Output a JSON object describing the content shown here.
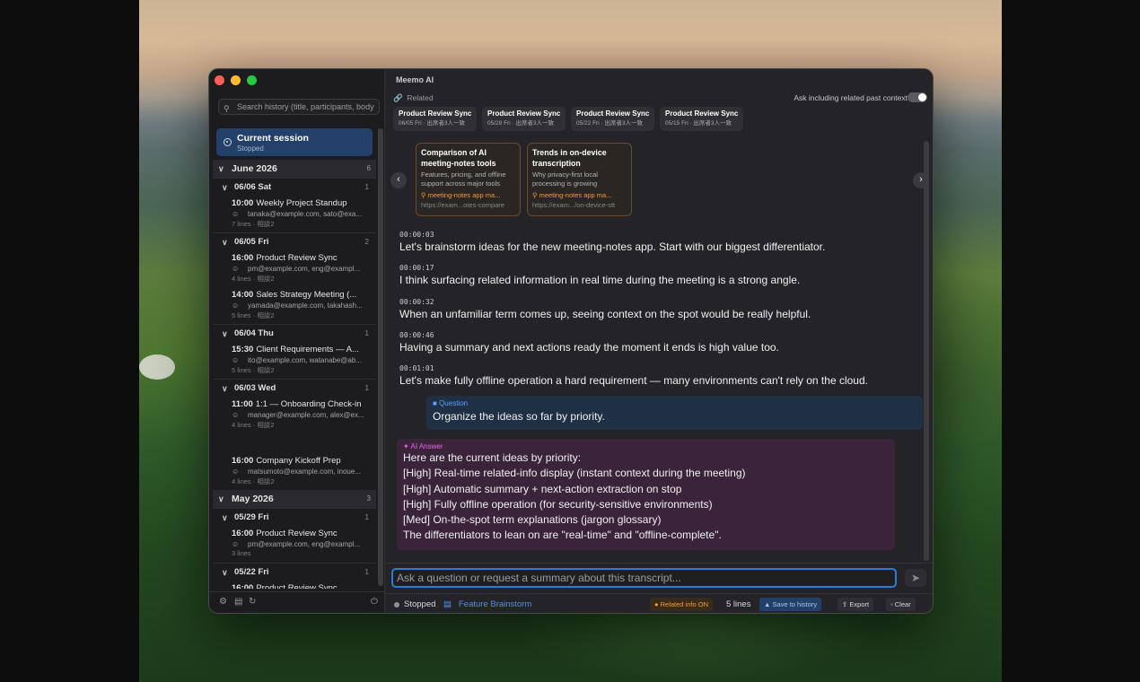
{
  "app": {
    "title": "Meemo AI"
  },
  "sidebar": {
    "search_placeholder": "Search history (title, participants, body",
    "current": {
      "label": "Current session",
      "status": "Stopped"
    },
    "months": [
      {
        "label": "June 2026",
        "count": "6",
        "days": [
          {
            "label": "06/06 Sat",
            "count": "1",
            "sessions": [
              {
                "time": "10:00",
                "title": "Weekly Project Standup",
                "people": "tanaka@example.com, sato@exa...",
                "meta": "7 lines · 相談2"
              }
            ]
          },
          {
            "label": "06/05 Fri",
            "count": "2",
            "sessions": [
              {
                "time": "16:00",
                "title": "Product Review Sync",
                "people": "pm@example.com, eng@exampl...",
                "meta": "4 lines · 相談2"
              },
              {
                "time": "14:00",
                "title": "Sales Strategy Meeting (...",
                "people": "yamada@example.com, takahash...",
                "meta": "5 lines · 相談2"
              }
            ]
          },
          {
            "label": "06/04 Thu",
            "count": "1",
            "sessions": [
              {
                "time": "15:30",
                "title": "Client Requirements — A...",
                "people": "ito@example.com, watanabe@ab...",
                "meta": "5 lines · 相談2"
              }
            ]
          },
          {
            "label": "06/03 Wed",
            "count": "1",
            "sessions": [
              {
                "time": "11:00",
                "title": "1:1 — Onboarding Check-in",
                "people": "manager@example.com, alex@ex...",
                "meta": "4 lines · 相談2"
              },
              {
                "time": "16:00",
                "title": "Company Kickoff Prep",
                "people": "matsumoto@example.com, inoue...",
                "meta": "4 lines · 相談2"
              }
            ]
          }
        ]
      },
      {
        "label": "May 2026",
        "count": "3",
        "days": [
          {
            "label": "05/29 Fri",
            "count": "1",
            "sessions": [
              {
                "time": "16:00",
                "title": "Product Review Sync",
                "people": "pm@example.com, eng@exampl...",
                "meta": "3 lines"
              }
            ]
          },
          {
            "label": "05/22 Fri",
            "count": "1",
            "sessions": [
              {
                "time": "16:00",
                "title": "Product Review Sync",
                "people": "",
                "meta": ""
              }
            ]
          }
        ]
      }
    ]
  },
  "related": {
    "label": "Related",
    "toggle_label": "Ask including related past context",
    "toggle_on": false,
    "chips": [
      {
        "title": "Product Review Sync",
        "sub": "06/05 Fri · 出席者3人一致"
      },
      {
        "title": "Product Review Sync",
        "sub": "05/29 Fri · 出席者3人一致"
      },
      {
        "title": "Product Review Sync",
        "sub": "05/22 Fri · 出席者3人一致"
      },
      {
        "title": "Product Review Sync",
        "sub": "05/15 Fri · 出席者3人一致"
      }
    ],
    "cards": [
      {
        "title": "Comparison of AI meeting-notes tools",
        "desc": "Features, pricing, and offline support across major tools",
        "query": "meeting-notes app ma...",
        "url": "https://exam...otes-compare"
      },
      {
        "title": "Trends in on-device transcription",
        "desc": "Why privacy-first local processing is growing",
        "query": "meeting-notes app ma...",
        "url": "https://exam.../on-device-stt"
      }
    ]
  },
  "transcript": [
    {
      "ts": "00:00:03",
      "text": "Let's brainstorm ideas for the new meeting-notes app. Start with our biggest differentiator."
    },
    {
      "ts": "00:00:17",
      "text": "I think surfacing related information in real time during the meeting is a strong angle."
    },
    {
      "ts": "00:00:32",
      "text": "When an unfamiliar term comes up, seeing context on the spot would be really helpful."
    },
    {
      "ts": "00:00:46",
      "text": "Having a summary and next actions ready the moment it ends is high value too."
    },
    {
      "ts": "00:01:01",
      "text": "Let's make fully offline operation a hard requirement — many environments can't rely on the cloud."
    }
  ],
  "question": {
    "label": "Question",
    "text": "Organize the ideas so far by priority."
  },
  "answer": {
    "label": "AI Answer",
    "lines": [
      "Here are the current ideas by priority:",
      "[High] Real-time related-info display (instant context during the meeting)",
      "[High] Automatic summary + next-action extraction on stop",
      "[High] Fully offline operation (for security-sensitive environments)",
      "[Med] On-the-spot term explanations (jargon glossary)",
      "The differentiators to lean on are \"real-time\" and \"offline-complete\"."
    ]
  },
  "input": {
    "placeholder": "Ask a question or request a summary about this transcript..."
  },
  "footer": {
    "status": "Stopped",
    "session_title": "Feature Brainstorm",
    "related_badge": "Related info ON",
    "lines": "5 lines",
    "save": "Save to history",
    "export": "Export",
    "clear": "Clear"
  },
  "colors": {
    "accent": "#2e7bd6",
    "question_bg": "#1f2f44",
    "answer_bg": "#3b2339",
    "related_border": "#6b4a2e"
  }
}
